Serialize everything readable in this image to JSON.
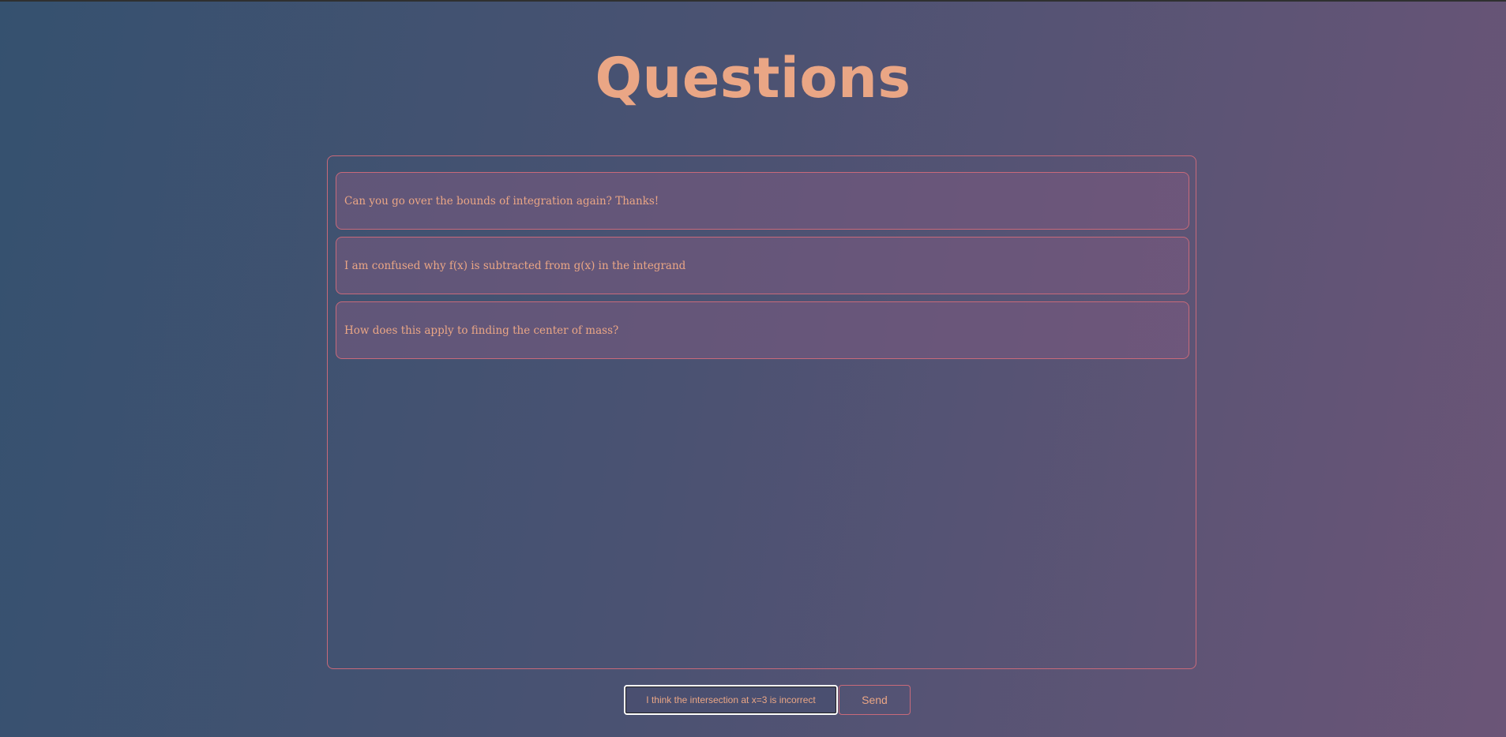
{
  "header": {
    "title": "Questions"
  },
  "questions": [
    "Can you go over the bounds of integration again? Thanks!",
    "I am confused why f(x) is subtracted from g(x) in the integrand",
    "How does this apply to finding the center of mass?"
  ],
  "composer": {
    "input_value": "I think the intersection at x=3 is incorrect",
    "send_label": "Send"
  },
  "colors": {
    "accent": "#eaa685",
    "border": "#c86a7a",
    "gradient_start": "#35516f",
    "gradient_end": "#6b5577"
  }
}
